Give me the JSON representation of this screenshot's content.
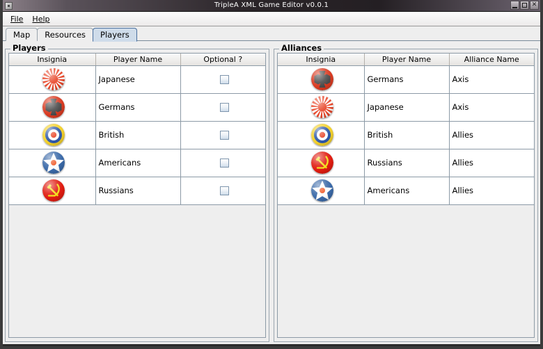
{
  "window": {
    "title": "TripleA XML Game Editor v0.0.1",
    "icon": "window-icon",
    "buttons": [
      {
        "name": "minimize",
        "glyph": ""
      },
      {
        "name": "maximize",
        "glyph": ""
      },
      {
        "name": "close",
        "glyph": "✕"
      }
    ]
  },
  "menubar": {
    "items": [
      {
        "label": "File",
        "mnemonic": "F"
      },
      {
        "label": "Help",
        "mnemonic": "H"
      }
    ]
  },
  "tabs": {
    "items": [
      {
        "label": "Map",
        "selected": false
      },
      {
        "label": "Resources",
        "selected": false
      },
      {
        "label": "Players",
        "selected": true
      }
    ]
  },
  "players_panel": {
    "title": "Players",
    "columns": [
      "Insignia",
      "Player Name",
      "Optional ?"
    ],
    "rows": [
      {
        "insignia": "japan-rising-sun-insignia",
        "name": "Japanese",
        "optional": false
      },
      {
        "insignia": "germany-iron-cross-insignia",
        "name": "Germans",
        "optional": false
      },
      {
        "insignia": "britain-roundel-insignia",
        "name": "British",
        "optional": false
      },
      {
        "insignia": "usa-star-roundel-insignia",
        "name": "Americans",
        "optional": false
      },
      {
        "insignia": "russia-hammer-sickle-insignia",
        "name": "Russians",
        "optional": false
      }
    ]
  },
  "alliances_panel": {
    "title": "Alliances",
    "columns": [
      "Insignia",
      "Player Name",
      "Alliance Name"
    ],
    "rows": [
      {
        "insignia": "germany-iron-cross-insignia",
        "name": "Germans",
        "alliance": "Axis"
      },
      {
        "insignia": "japan-rising-sun-insignia",
        "name": "Japanese",
        "alliance": "Axis"
      },
      {
        "insignia": "britain-roundel-insignia",
        "name": "British",
        "alliance": "Allies"
      },
      {
        "insignia": "russia-hammer-sickle-insignia",
        "name": "Russians",
        "alliance": "Allies"
      },
      {
        "insignia": "usa-star-roundel-insignia",
        "name": "Americans",
        "alliance": "Allies"
      }
    ]
  },
  "colors": {
    "titlebar_text": "#ffffff",
    "tab_selected_bg": "#cfdcea",
    "tab_selected_border": "#4a6f9e",
    "panel_bg": "#eeeeee",
    "table_bg": "#ffffff",
    "grid_line": "#8c9aa6",
    "japan_red": "#e8472a",
    "germany_red": "#d93a21",
    "germany_cross": "#4a4a4a",
    "britain_yellow": "#f2d02c",
    "britain_blue": "#2c56a8",
    "britain_red": "#e8472a",
    "usa_blue": "#3a69a8",
    "usa_red": "#f05a28",
    "russia_red": "#e01b10",
    "russia_yellow": "#f2dd16"
  }
}
